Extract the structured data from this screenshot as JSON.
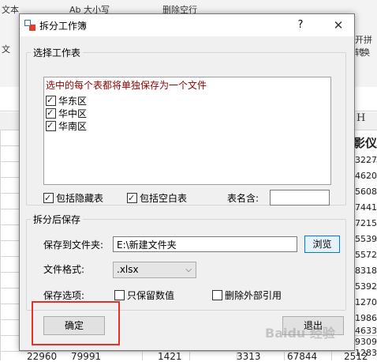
{
  "background": {
    "ribbon_fragments": [
      "文本",
      "Ab 大小写",
      "删除空行",
      "开拼转",
      "文",
      "换"
    ],
    "column_header": "H",
    "right_column": [
      "影仪",
      "3227",
      "4620",
      "5608",
      "7441",
      "7215",
      "5539",
      "5572",
      "8318",
      "5392",
      "1270",
      "1986",
      "4633",
      "9309",
      "1283"
    ],
    "bottom_row": [
      "22960",
      "79991",
      "1421",
      "3313",
      "67844",
      "2512"
    ]
  },
  "dialog": {
    "title": "拆分工作簿",
    "help": "?",
    "close": "✕",
    "select_group": {
      "label": "选择工作表",
      "hint": "选中的每个表都将单独保存为一个文件",
      "sheets": [
        {
          "name": "华东区",
          "checked": true
        },
        {
          "name": "华中区",
          "checked": true
        },
        {
          "name": "华南区",
          "checked": true
        }
      ],
      "include_hidden": "包括隐藏表",
      "include_blank": "包括空白表",
      "name_contains_label": "表名含:",
      "name_contains_value": ""
    },
    "save_group": {
      "label": "拆分后保存",
      "folder_label": "保存到文件夹:",
      "folder_value": "E:\\新建文件夹",
      "browse": "浏览",
      "format_label": "文件格式:",
      "format_value": ".xlsx",
      "options_label": "保存选项:",
      "keep_values": "只保留数值",
      "remove_external": "删除外部引用"
    },
    "ok": "确定",
    "exit": "退出"
  },
  "watermark": "Baidu 经验",
  "colors": {
    "hint": "#8b0000",
    "highlight": "#e0312a",
    "focus": "#0078d7"
  }
}
